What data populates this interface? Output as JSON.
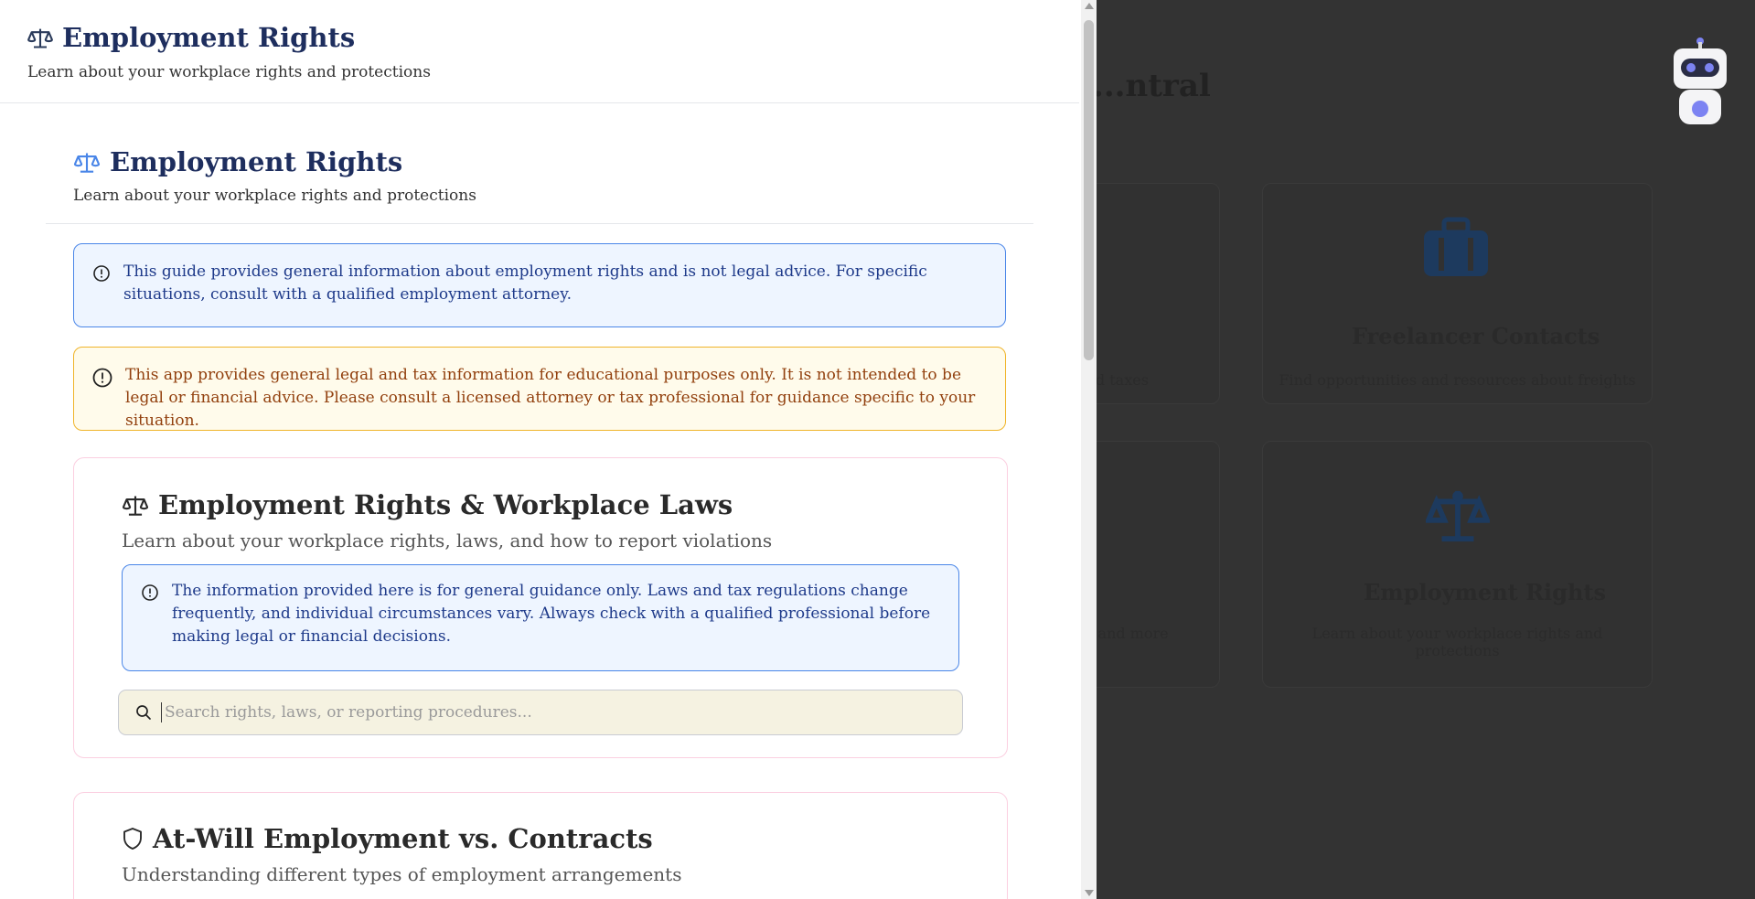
{
  "background": {
    "heading": "...ntral",
    "cards": [
      {
        "icon": "briefcase-icon",
        "title": "Freelancer Contacts",
        "desc": "Find opportunities and resources about freights"
      },
      {
        "icon": "scale-icon",
        "title": "Employment Rights",
        "desc": "Learn about your workplace rights and protections"
      }
    ],
    "left_card_desc_1": "and taxes",
    "left_card_desc_2": "unds and more"
  },
  "drawer": {
    "title": "Employment Rights",
    "subtitle": "Learn about your workplace rights and protections",
    "inner_title": "Employment Rights",
    "inner_subtitle": "Learn about your workplace rights and protections",
    "info_alert": "This guide provides general information about employment rights and is not legal advice. For specific situations, consult with a qualified employment attorney.",
    "warning_alert": "This app provides general legal and tax information for educational purposes only. It is not intended to be legal or financial advice. Please consult a licensed attorney or tax professional for guidance specific to your situation.",
    "section1": {
      "title": "Employment Rights & Workplace Laws",
      "subtitle": "Learn about your workplace rights, laws, and how to report violations",
      "notice": "The information provided here is for general guidance only. Laws and tax regulations change frequently, and individual circumstances vary. Always check with a qualified professional before making legal or financial decisions.",
      "search_placeholder": "Search rights, laws, or reporting procedures...",
      "search_value": ""
    },
    "section2": {
      "title": "At-Will Employment vs. Contracts",
      "subtitle": "Understanding different types of employment arrangements"
    }
  },
  "colors": {
    "title_navy": "#1e2e5e",
    "info_blue": "#4a86e8",
    "warn_amber": "#f0b429",
    "overlay": "#333333",
    "search_bg": "#f5f2e1"
  }
}
